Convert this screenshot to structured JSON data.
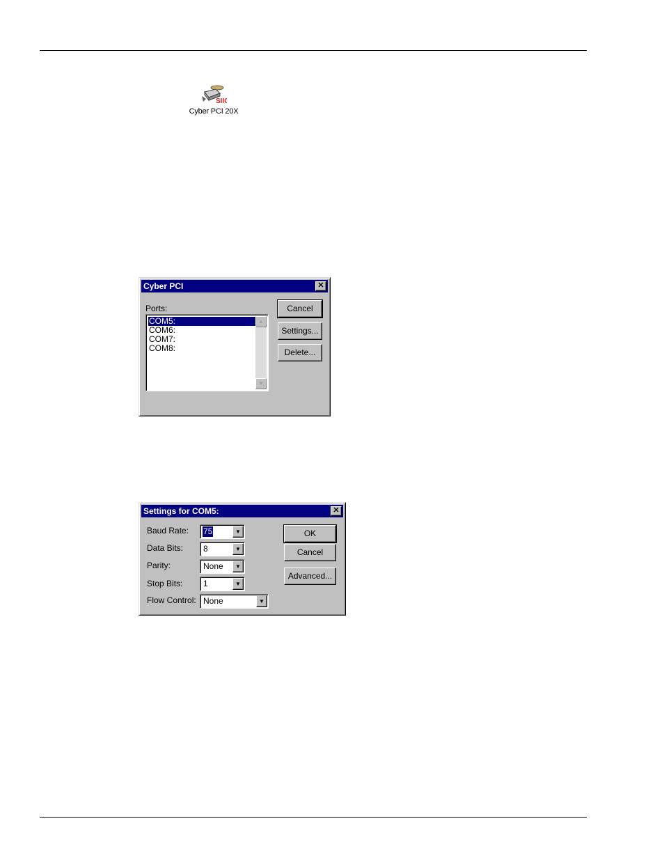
{
  "desktop_icon": {
    "label": "Cyber PCI 20X",
    "brand": "SIIG",
    "icon": "serial-card-icon"
  },
  "ports_dialog": {
    "title": "Cyber PCI",
    "ports_label": "Ports:",
    "ports": [
      "COM5:",
      "COM6:",
      "COM7:",
      "COM8:"
    ],
    "selected_port": "COM5:",
    "buttons": {
      "cancel": "Cancel",
      "settings": "Settings...",
      "delete": "Delete..."
    }
  },
  "settings_dialog": {
    "title": "Settings for COM5:",
    "fields": {
      "baud_rate": {
        "label": "Baud Rate:",
        "value": "75"
      },
      "data_bits": {
        "label": "Data Bits:",
        "value": "8"
      },
      "parity": {
        "label": "Parity:",
        "value": "None"
      },
      "stop_bits": {
        "label": "Stop Bits:",
        "value": "1"
      },
      "flow_control": {
        "label": "Flow Control:",
        "value": "None"
      }
    },
    "buttons": {
      "ok": "OK",
      "cancel": "Cancel",
      "advanced": "Advanced..."
    }
  },
  "colors": {
    "titlebar": "#000080",
    "dialog_face": "#c0c0c0",
    "brand_red": "#e02020"
  }
}
